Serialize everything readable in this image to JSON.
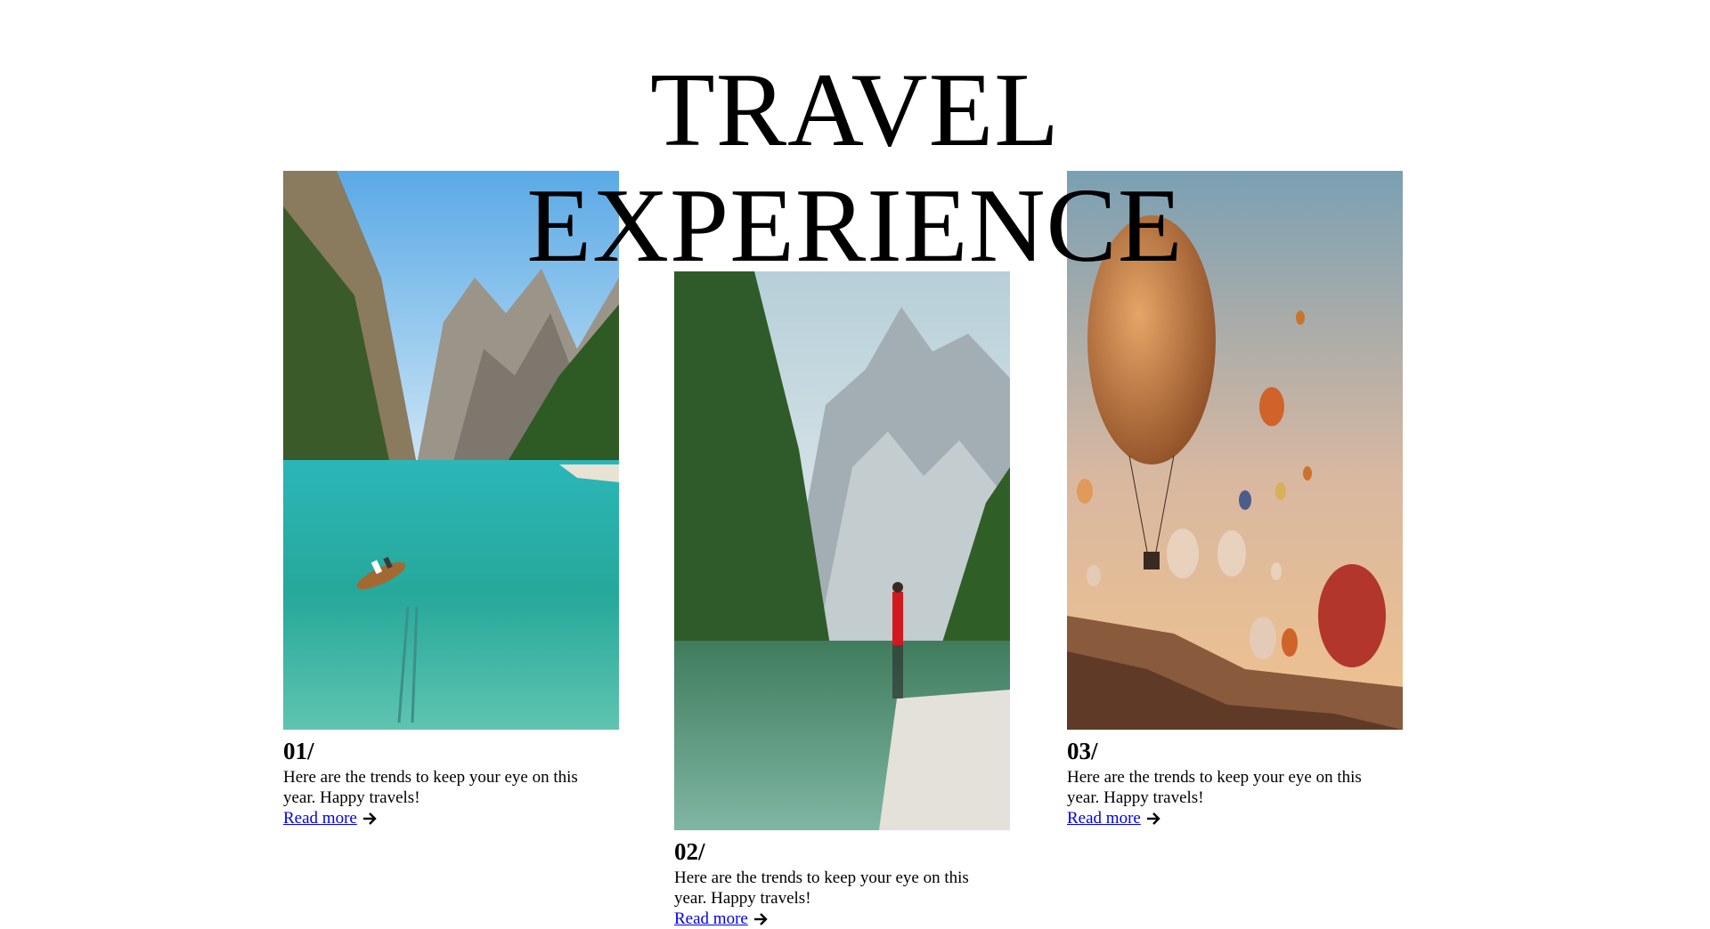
{
  "header": {
    "title_line1": "TRAVEL",
    "title_line2": "EXPERIENCE"
  },
  "cards": [
    {
      "number": "01/",
      "text": "Here are the trends to keep your eye on this year. Happy travels!",
      "link": "Read more",
      "image": "lake-with-boat-mountains",
      "link_icon": "arrow-right-icon"
    },
    {
      "number": "02/",
      "text": "Here are the trends to keep your eye on this year. Happy travels!",
      "link": "Read more",
      "image": "person-in-red-by-mountain-lake",
      "link_icon": "arrow-right-icon"
    },
    {
      "number": "03/",
      "text": "Here are the trends to keep your eye on this year. Happy travels!",
      "link": "Read more",
      "image": "hot-air-balloons-at-sunset",
      "link_icon": "arrow-right-icon"
    }
  ],
  "colors": {
    "link": "#0000ee",
    "text": "#000000",
    "background": "#ffffff"
  }
}
